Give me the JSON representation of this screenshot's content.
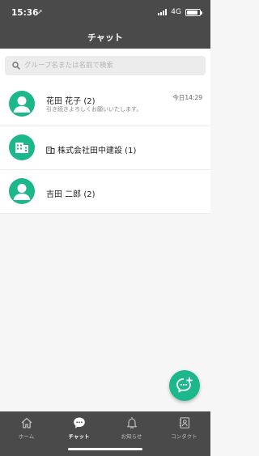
{
  "status_bar": {
    "time": "15:36",
    "location_glyph": "➚",
    "network": "4G",
    "battery_level": 0.85
  },
  "header": {
    "title": "チャット"
  },
  "search": {
    "placeholder": "グループ名または名前で検索",
    "value": ""
  },
  "chats": [
    {
      "name": "花田 花子 (2)",
      "preview": "引き続きよろしくお願いいたします。",
      "time": "今日14:29",
      "avatar": "person-icon"
    },
    {
      "name": "株式会社田中建設 (1)",
      "avatar": "building-icon",
      "badge_icon": "company-icon"
    },
    {
      "name": "吉田 二郎 (2)",
      "avatar": "person-icon"
    }
  ],
  "tabs": [
    {
      "label": "ホーム",
      "icon": "home-icon",
      "active": false
    },
    {
      "label": "チャット",
      "icon": "chat-icon",
      "active": true
    },
    {
      "label": "お知らせ",
      "icon": "bell-icon",
      "active": false
    },
    {
      "label": "コンタクト",
      "icon": "contact-icon",
      "active": false
    }
  ],
  "fab": {
    "icon": "new-chat-icon"
  },
  "colors": {
    "accent": "#1cb78a",
    "header_bg": "#4a4a4a",
    "tab_bg": "#4a4a4a",
    "list_bg": "#ffffff",
    "page_bg": "#f6f6f6"
  }
}
